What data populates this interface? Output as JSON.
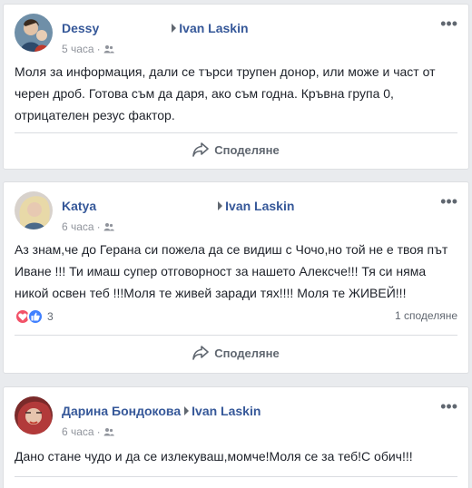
{
  "posts": [
    {
      "author": "Dessy",
      "recipient": "Ivan Laskin",
      "time": "5 часа",
      "text": "Моля за информация, дали се търси трупен донор, или може и част от черен дроб. Готова съм да даря, ако съм годна. Кръвна група 0, отрицателен резус фактор.",
      "share_label": "Споделяне",
      "avatar_color": "#4a6d8c"
    },
    {
      "author": "Katya",
      "recipient": "Ivan Laskin",
      "time": "6 часа",
      "text": "Аз знам,че до Герана си пожела да се видиш с Чочо,но той не е твоя път Иване !!! Ти имаш супер отговорност за нашето Алексче!!! Тя си няма никой освен теб !!!Моля те живей заради тях!!!! Моля те ЖИВЕЙ!!!",
      "reaction_count": "3",
      "shares": "1 споделяне",
      "share_label": "Споделяне",
      "avatar_color": "#c9b8a8"
    },
    {
      "author": "Дарина Бондокова",
      "recipient": "Ivan Laskin",
      "time": "6 часа",
      "text": "Дано стане чудо и да се излекуваш,момче!Моля се за теб!С обич!!!",
      "avatar_color": "#b23a3a"
    }
  ],
  "colors": {
    "link": "#365899",
    "love": "#f25268",
    "like": "#4080ff"
  },
  "icons": [
    "more-icon",
    "group-icon",
    "share-icon",
    "love-reaction-icon",
    "like-reaction-icon"
  ]
}
